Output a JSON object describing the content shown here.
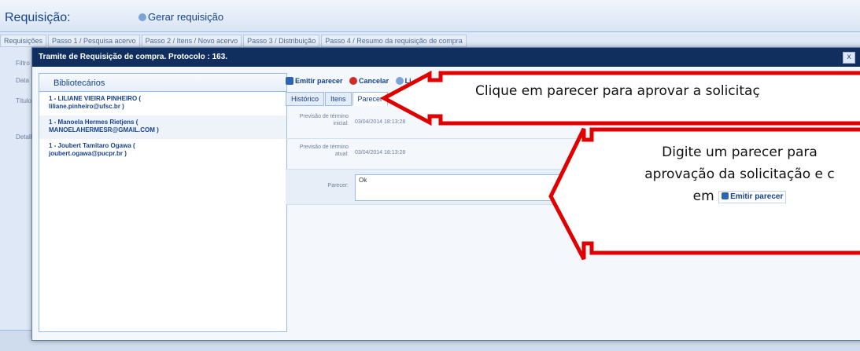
{
  "background": {
    "title": "Requisição:",
    "gerar": "Gerar requisição",
    "tabs": [
      "Requisições",
      "Passo 1 / Pesquisa acervo",
      "Passo 2 / Itens / Novo acervo",
      "Passo 3 / Distribuição",
      "Passo 4 / Resumo da requisição de compra"
    ],
    "labels": [
      "Filtro",
      "Data",
      "Título",
      "Detalhes"
    ]
  },
  "modal": {
    "title": "Tramite de Requisição de compra. Protocolo : 163.",
    "close": "x"
  },
  "left": {
    "header": "Bibliotecários",
    "people": [
      {
        "line1": "1 - LILIANE VIEIRA PINHEIRO (",
        "line2": "liliane.pinheiro@ufsc.br )"
      },
      {
        "line1": "1 - Manoela Hermes Rietjens (",
        "line2": "MANOELAHERMESR@GMAIL.COM )"
      },
      {
        "line1": "1 - Joubert Tamitaro Ogawa (",
        "line2": "joubert.ogawa@pucpr.br )"
      }
    ]
  },
  "toolbar": {
    "emitir": "Emitir parecer",
    "cancelar": "Cancelar",
    "more": "Li"
  },
  "tabs": [
    "Histórico",
    "Itens",
    "Parecer"
  ],
  "form": {
    "prev_inicial_label": "Previsão de término inicial:",
    "prev_inicial_value": "03/04/2014 18:13:28",
    "prev_atual_label": "Previsão de término atual:",
    "prev_atual_value": "03/04/2014 18:13:28",
    "parecer_label": "Parecer:",
    "parecer_value": "Ok"
  },
  "callouts": {
    "c1": "Clique em parecer para aprovar a solicitaç",
    "c2_line1": "Digite um parecer para",
    "c2_line2": "aprovação da solicitação e c",
    "c2_line3": "em",
    "c2_button": "Emitir parecer"
  },
  "colors": {
    "callout_border": "#e00000",
    "modal_title_bg": "#102f5f"
  }
}
